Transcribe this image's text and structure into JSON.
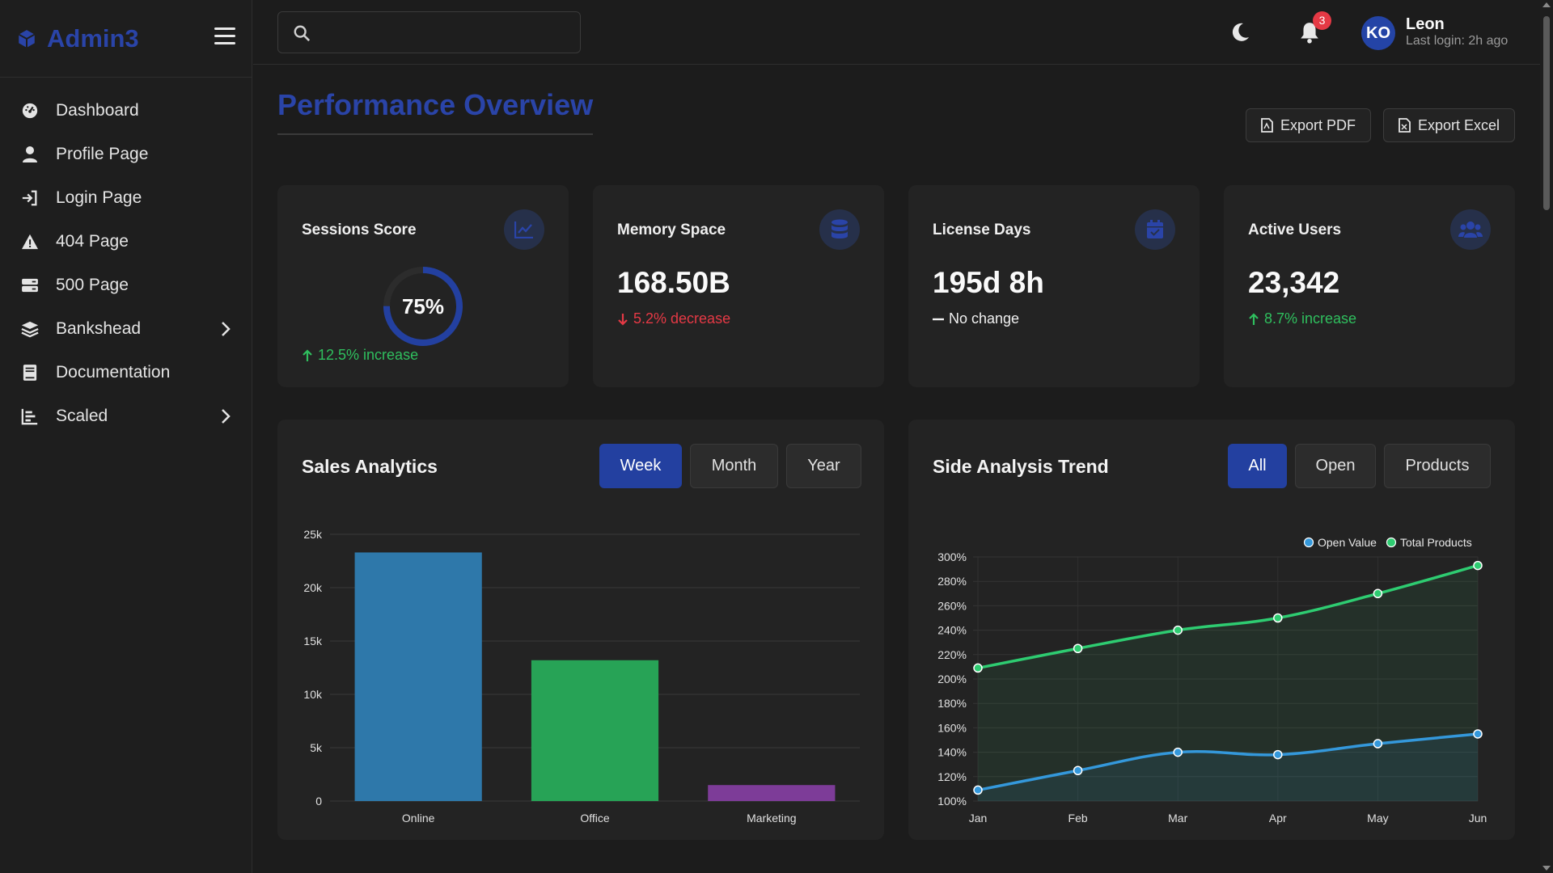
{
  "brand": {
    "name": "Admin3"
  },
  "sidebar": {
    "items": [
      {
        "label": "Dashboard",
        "icon": "gauge-icon"
      },
      {
        "label": "Profile Page",
        "icon": "user-icon"
      },
      {
        "label": "Login Page",
        "icon": "sign-in-icon"
      },
      {
        "label": "404 Page",
        "icon": "warning-icon"
      },
      {
        "label": "500 Page",
        "icon": "server-icon"
      },
      {
        "label": "Bankshead",
        "icon": "layers-icon",
        "has_submenu": true
      },
      {
        "label": "Documentation",
        "icon": "book-icon"
      },
      {
        "label": "Scaled",
        "icon": "chart-bars-icon",
        "has_submenu": true
      }
    ]
  },
  "topbar": {
    "search_placeholder": "",
    "notifications_count": "3",
    "user": {
      "initials": "KO",
      "name": "Leon",
      "last_login": "Last login: 2h ago"
    }
  },
  "page": {
    "title": "Performance Overview",
    "export_pdf": "Export PDF",
    "export_excel": "Export Excel"
  },
  "stats": [
    {
      "title": "Sessions Score",
      "value": "75%",
      "gauge_fraction": 0.75,
      "change": "12.5% increase",
      "trend": "up",
      "icon": "line-chart-icon"
    },
    {
      "title": "Memory Space",
      "value": "168.50B",
      "change": "5.2% decrease",
      "trend": "down",
      "icon": "database-icon"
    },
    {
      "title": "License Days",
      "value": "195d 8h",
      "change": "No change",
      "trend": "neutral",
      "icon": "calendar-icon"
    },
    {
      "title": "Active Users",
      "value": "23,342",
      "change": "8.7% increase",
      "trend": "up",
      "icon": "users-icon"
    }
  ],
  "sales": {
    "title": "Sales Analytics",
    "tabs": [
      "Week",
      "Month",
      "Year"
    ],
    "active_tab": "Week"
  },
  "trend": {
    "title": "Side Analysis Trend",
    "tabs": [
      "All",
      "Open",
      "Products"
    ],
    "active_tab": "All"
  },
  "colors": {
    "accent": "#2340a0",
    "up": "#2fbf5e",
    "down": "#e53945",
    "bar1": "#2e78aa",
    "bar2": "#27a356",
    "bar3": "#7d3c98",
    "line_total": "#2ecc71",
    "line_open": "#3498db"
  },
  "chart_data": [
    {
      "type": "bar",
      "categories": [
        "Online",
        "Office",
        "Marketing"
      ],
      "values": [
        23300,
        13200,
        1500
      ],
      "ylim": [
        0,
        25000
      ],
      "yticks": [
        "0",
        "5k",
        "10k",
        "15k",
        "20k",
        "25k"
      ],
      "grid": true
    },
    {
      "type": "area",
      "categories": [
        "Jan",
        "Feb",
        "Mar",
        "Apr",
        "May",
        "Jun"
      ],
      "series": [
        {
          "name": "Open Value",
          "values": [
            109,
            125,
            140,
            138,
            147,
            155
          ]
        },
        {
          "name": "Total Products",
          "values": [
            209,
            225,
            240,
            250,
            270,
            293
          ]
        }
      ],
      "ylim": [
        100,
        300
      ],
      "yticks": [
        "100%",
        "120%",
        "140%",
        "160%",
        "180%",
        "200%",
        "220%",
        "240%",
        "260%",
        "280%",
        "300%"
      ],
      "legend": "top-right",
      "grid": true
    }
  ]
}
